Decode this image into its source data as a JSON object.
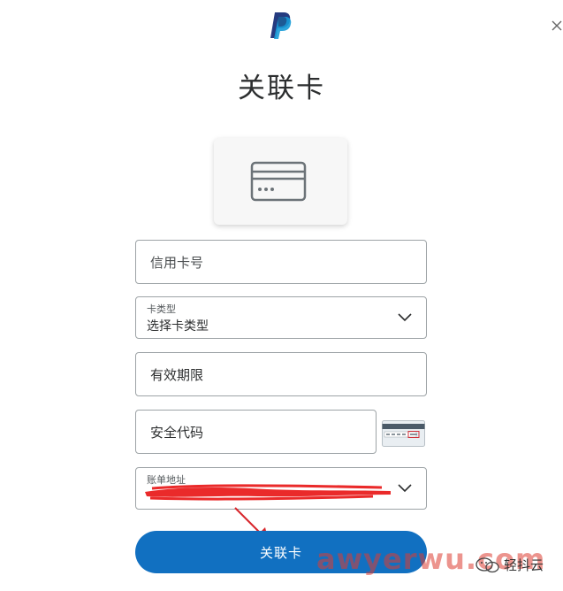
{
  "header": {
    "logo_icon": "paypal-logo-icon",
    "close_icon": "close-icon"
  },
  "title": "关联卡",
  "card_icon": "credit-card-icon",
  "form": {
    "card_number": {
      "placeholder": "信用卡号"
    },
    "card_type": {
      "label": "卡类型",
      "value": "选择卡类型"
    },
    "expiry": {
      "placeholder": "有效期限"
    },
    "security_code": {
      "placeholder": "安全代码"
    },
    "billing_address": {
      "label": "账单地址"
    }
  },
  "submit_label": "关联卡",
  "watermark": {
    "site": "awyerwu.com",
    "wechat_label": "轻抖云"
  },
  "colors": {
    "accent": "#1170c1",
    "redaction": "#ea2a2a",
    "watermark": "#dc3c32"
  }
}
